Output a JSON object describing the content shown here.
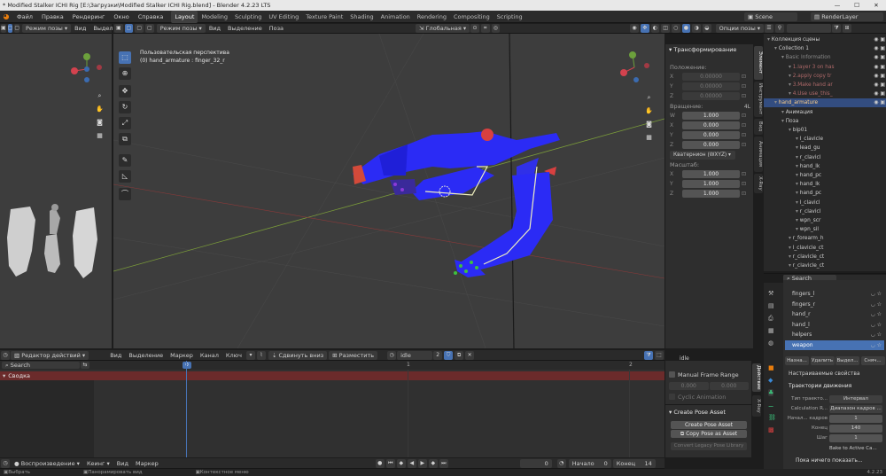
{
  "titlebar": {
    "title": "* Modified Stalker ICHI Rig [E:\\Загрузки\\Modified Stalker ICHI Rig.blend] - Blender 4.2.23 LTS",
    "minimize": "—",
    "maximize": "☐",
    "close": "✕"
  },
  "menu": {
    "items": [
      "Файл",
      "Правка",
      "Рендеринг",
      "Окно",
      "Справка"
    ],
    "workspaces": [
      "Layout",
      "Modeling",
      "Sculpting",
      "UV Editing",
      "Texture Paint",
      "Shading",
      "Animation",
      "Rendering",
      "Compositing",
      "Scripting"
    ],
    "active_workspace": "Layout",
    "scene": "Scene",
    "view_layer": "RenderLayer"
  },
  "left_viewport": {
    "mode": "Режим позы",
    "menu": [
      "Вид",
      "Выдел"
    ],
    "options": "Опции"
  },
  "main_viewport": {
    "mode": "Режим позы",
    "menu": [
      "Вид",
      "Выделение",
      "Поза"
    ],
    "orientation": "Глобальная",
    "options": "Опции позы",
    "perspective": "Пользовательская перспектива",
    "active": "(0) hand_armature : finger_32_r"
  },
  "npanel": {
    "title": "Трансформирование",
    "location_label": "Положение:",
    "location": [
      {
        "axis": "X",
        "value": "0.00000"
      },
      {
        "axis": "Y",
        "value": "0.00000"
      },
      {
        "axis": "Z",
        "value": "0.00000"
      }
    ],
    "rotation_label": "Вращение:",
    "rotation_mode_short": "4L",
    "rotation": [
      {
        "axis": "W",
        "value": "1.000"
      },
      {
        "axis": "X",
        "value": "0.000"
      },
      {
        "axis": "Y",
        "value": "0.000"
      },
      {
        "axis": "Z",
        "value": "0.000"
      }
    ],
    "rotation_mode": "Кватернион (WXYZ)",
    "scale_label": "Масштаб:",
    "scale": [
      {
        "axis": "X",
        "value": "1.000"
      },
      {
        "axis": "Y",
        "value": "1.000"
      },
      {
        "axis": "Z",
        "value": "1.000"
      }
    ],
    "tabs": [
      "Элемент",
      "Инструмент",
      "Вид",
      "Анимация",
      "X-Ray"
    ]
  },
  "outliner": {
    "search_placeholder": "",
    "rows": [
      {
        "indent": 0,
        "text": "Коллекция сцены",
        "color": "#cfcfcf"
      },
      {
        "indent": 1,
        "text": "Collection 1",
        "color": "#cfcfcf"
      },
      {
        "indent": 2,
        "text": "Basic Information",
        "color": "#8a8a8a"
      },
      {
        "indent": 3,
        "text": "1.layer 3 on has",
        "color": "#b06a6a"
      },
      {
        "indent": 3,
        "text": "2.apply copy tr",
        "color": "#b06a6a"
      },
      {
        "indent": 3,
        "text": "3.Make hand ar",
        "color": "#b06a6a"
      },
      {
        "indent": 3,
        "text": "4.Use use_this_",
        "color": "#b06a6a"
      },
      {
        "indent": 1,
        "text": "hand_armature",
        "color": "#ffd08a",
        "hl": true
      },
      {
        "indent": 2,
        "text": "Анимация",
        "color": "#cfcfcf"
      },
      {
        "indent": 2,
        "text": "Поза",
        "color": "#cfcfcf"
      },
      {
        "indent": 3,
        "text": "bip01",
        "color": "#cfcfcf"
      },
      {
        "indent": 4,
        "text": "l_clavicle",
        "color": "#cfcfcf"
      },
      {
        "indent": 4,
        "text": "lead_gu",
        "color": "#cfcfcf"
      },
      {
        "indent": 4,
        "text": "r_clavicl",
        "color": "#cfcfcf"
      },
      {
        "indent": 4,
        "text": "hand_lk",
        "color": "#cfcfcf"
      },
      {
        "indent": 4,
        "text": "hand_pc",
        "color": "#cfcfcf"
      },
      {
        "indent": 4,
        "text": "hand_lk",
        "color": "#cfcfcf"
      },
      {
        "indent": 4,
        "text": "hand_pc",
        "color": "#cfcfcf"
      },
      {
        "indent": 4,
        "text": "l_clavicl",
        "color": "#cfcfcf"
      },
      {
        "indent": 4,
        "text": "r_clavicl",
        "color": "#cfcfcf"
      },
      {
        "indent": 4,
        "text": "wpn_scr",
        "color": "#cfcfcf"
      },
      {
        "indent": 4,
        "text": "wpn_sil",
        "color": "#cfcfcf"
      },
      {
        "indent": 3,
        "text": "r_forearm_h",
        "color": "#cfcfcf"
      },
      {
        "indent": 3,
        "text": "l_clavicle_ct",
        "color": "#cfcfcf"
      },
      {
        "indent": 3,
        "text": "r_clavicle_ct",
        "color": "#cfcfcf"
      },
      {
        "indent": 3,
        "text": "r_clavicle_ct",
        "color": "#cfcfcf"
      }
    ]
  },
  "properties": {
    "search_placeholder": "Search",
    "bone_collections": [
      "fingers_l",
      "fingers_r",
      "hand_r",
      "hand_l",
      "helpers",
      "weapon"
    ],
    "selected_collection": "weapon",
    "buttons": [
      "Назна...",
      "Удалить",
      "Выдел...",
      "Сняч..."
    ],
    "custom_props": "Настраиваемые свойства",
    "motion_paths": "Траектории движения",
    "path_type_label": "Тип траекто...",
    "path_type": "Интервал",
    "calc_range_label": "Calculation R...",
    "calc_range": "Диапазон кадров ...",
    "start_label": "Начал... кадров",
    "start": "1",
    "end_label": "Конец",
    "end": "140",
    "step_label": "Шаг",
    "step": "1",
    "bake": "Bake to Active Ca...",
    "nothing": "Пока ничего показать..."
  },
  "action_editor": {
    "editor": "Редактор действий",
    "menu": [
      "Вид",
      "Выделение",
      "Маркер",
      "Канал",
      "Ключ"
    ],
    "push_down": "Сдвинуть вниз",
    "stash": "Разместить",
    "action_name": "idle",
    "users": "2",
    "search_placeholder": "Search",
    "summary": "Сводка",
    "frame_marks": [
      "0",
      "1",
      "2"
    ],
    "side": {
      "action_label": "idle",
      "manual_range": "Manual Frame Range",
      "start": "0.000",
      "end": "0.000",
      "cyclic": "Cyclic Animation",
      "create_pose": "Create Pose Asset",
      "create_btn": "Create Pose Asset",
      "copy_btn": "Copy Pose as Asset",
      "convert_btn": "Convert Legacy Pose Library"
    },
    "side_tabs": [
      "Действие",
      "X-Ray"
    ]
  },
  "timeline": {
    "playback": "Воспроизведение",
    "keying": "Кеинг",
    "menu": [
      "Вид",
      "Маркер"
    ],
    "current": "0",
    "start_label": "Начало",
    "start": "0",
    "end_label": "Конец",
    "end": "14"
  },
  "status": {
    "left": "Выбрать",
    "mid": "Панорамировать вид",
    "right": "Контекстное меню",
    "version": "4.2.23"
  },
  "colors": {
    "accent": "#4772b3",
    "mesh_blue": "#2b2bf5",
    "bone_yellow": "#f0f0c0",
    "timeline_red": "#6b2b2b",
    "playhead": "#4772b3"
  }
}
